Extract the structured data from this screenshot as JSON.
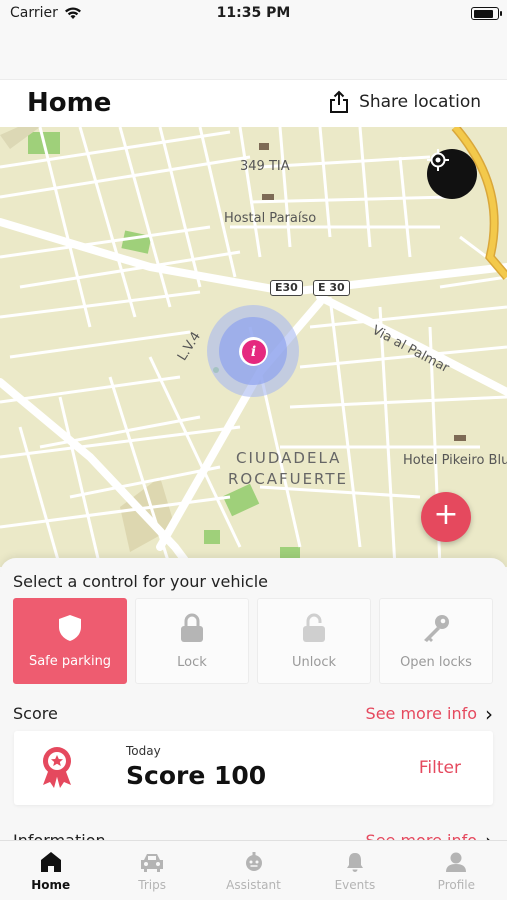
{
  "status_bar": {
    "carrier": "Carrier",
    "time": "11:35 PM",
    "battery_level": 0.9
  },
  "header": {
    "title": "Home",
    "share_label": "Share location"
  },
  "map": {
    "labels": {
      "poi_1": "349 TIA",
      "hotel_1": "Hostal Paraíso",
      "road_shield_1": "E30",
      "road_shield_2": "E 30",
      "street_1": "L.V.4",
      "street_2": "Via al Palmar",
      "district_line_1": "CIUDADELA",
      "district_line_2": "ROCAFUERTE",
      "hotel_2": "Hotel Pikeiro Blu"
    },
    "marker_icon": "info-marker-icon",
    "add_label": "+"
  },
  "controls": {
    "title": "Select a control for your vehicle",
    "items": [
      {
        "label": "Safe parking",
        "icon": "shield-icon",
        "active": true
      },
      {
        "label": "Lock",
        "icon": "lock-icon",
        "active": false
      },
      {
        "label": "Unlock",
        "icon": "unlock-icon",
        "active": false
      },
      {
        "label": "Open locks",
        "icon": "key-icon",
        "active": false
      }
    ]
  },
  "score": {
    "label": "Score",
    "see_more": "See more info",
    "card": {
      "period": "Today",
      "value": "Score 100",
      "filter": "Filter"
    }
  },
  "information": {
    "label": "Information",
    "see_more": "See more info"
  },
  "tabs": [
    {
      "label": "Home",
      "icon": "home-icon",
      "active": true
    },
    {
      "label": "Trips",
      "icon": "car-icon",
      "active": false
    },
    {
      "label": "Assistant",
      "icon": "assistant-icon",
      "active": false
    },
    {
      "label": "Events",
      "icon": "bell-icon",
      "active": false
    },
    {
      "label": "Profile",
      "icon": "profile-icon",
      "active": false
    }
  ],
  "colors": {
    "accent": "#e5495e",
    "map_land": "#ebe9c8",
    "map_road": "#ffffff",
    "map_highway": "#f3c94b",
    "map_park": "#9fd07a"
  }
}
